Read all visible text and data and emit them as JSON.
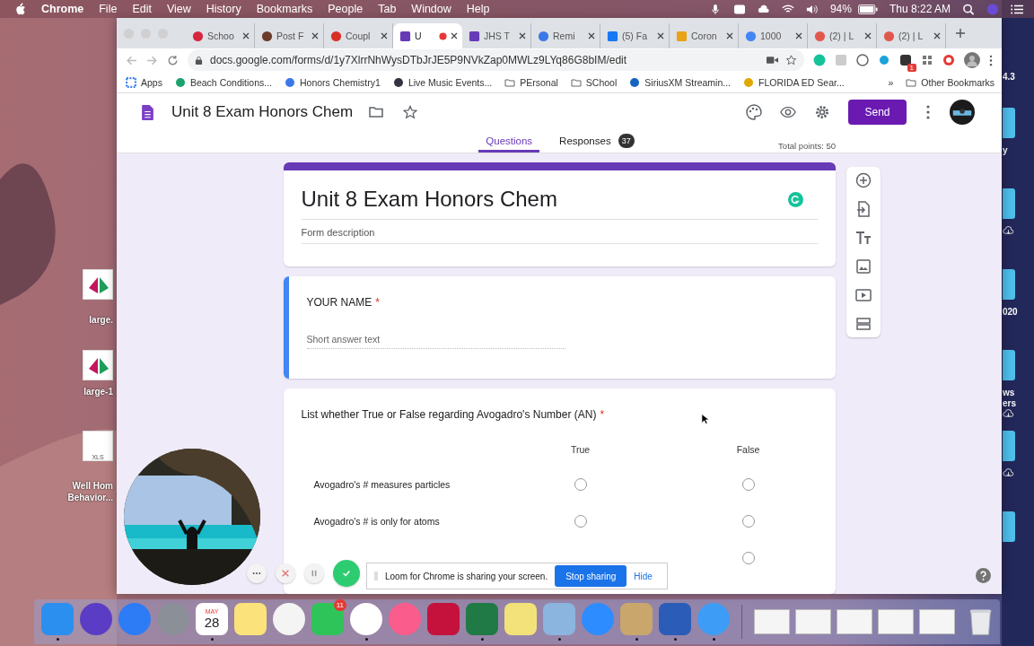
{
  "menu_bar": {
    "app": "Chrome",
    "menus": [
      "File",
      "Edit",
      "View",
      "History",
      "Bookmarks",
      "People",
      "Tab",
      "Window",
      "Help"
    ],
    "battery": "94%",
    "clock": "Thu 8:22 AM"
  },
  "desktop": {
    "left_icons": [
      {
        "kind": "chart",
        "lines": [
          "large."
        ]
      },
      {
        "kind": "chart",
        "lines": [
          "large-1"
        ]
      },
      {
        "kind": "sheet",
        "tag": "XLS",
        "lines": [
          "Well Hom",
          "Behavior..."
        ]
      }
    ],
    "top_label": "4.3",
    "right_icons": [
      {
        "lines": [
          "y"
        ],
        "cloud": false
      },
      {
        "cloud": true
      },
      {
        "lines": [
          "020"
        ],
        "cloud": false
      },
      {
        "lines": [
          "ws",
          "ers"
        ],
        "cloud": true
      },
      {
        "cloud": true
      },
      {
        "cloud": false
      }
    ]
  },
  "browser": {
    "tabs": [
      {
        "title": "Schoo",
        "selected": false,
        "recording": false
      },
      {
        "title": "Post F",
        "selected": false,
        "recording": false
      },
      {
        "title": "Coupl",
        "selected": false,
        "recording": false
      },
      {
        "title": "U",
        "selected": true,
        "recording": true
      },
      {
        "title": "JHS T",
        "selected": false,
        "recording": false
      },
      {
        "title": "Remi",
        "selected": false,
        "recording": false
      },
      {
        "title": "(5) Fa",
        "selected": false,
        "recording": false
      },
      {
        "title": "Coron",
        "selected": false,
        "recording": false
      },
      {
        "title": "1000",
        "selected": false,
        "recording": false
      },
      {
        "title": "(2) | L",
        "selected": false,
        "recording": false
      },
      {
        "title": "(2) | L",
        "selected": false,
        "recording": false
      }
    ],
    "url": "docs.google.com/forms/d/1y7XlrrNhWysDTbJrJE5P9NVkZap0MWLz9LYq86G8bIM/edit",
    "extension_badge": "1",
    "bookmarks": [
      "Apps",
      "Beach Conditions...",
      "Honors Chemistry1",
      "Live Music Events...",
      "PErsonal",
      "SChool",
      "SiriusXM Streamin...",
      "FLORIDA ED Sear..."
    ],
    "more_bookmarks": "»",
    "other_bookmarks": "Other Bookmarks"
  },
  "form": {
    "title": "Unit 8 Exam Honors Chem",
    "send": "Send",
    "tabs": [
      {
        "label": "Questions",
        "selected": true
      },
      {
        "label": "Responses",
        "selected": false,
        "count": "37"
      }
    ],
    "total_points": "Total points: 50",
    "header_card": {
      "title": "Unit 8 Exam Honors Chem",
      "placeholder": "Form description"
    },
    "questions": [
      {
        "kind": "short",
        "title": "YOUR NAME",
        "required_mark": "*",
        "selected": true,
        "placeholder": "Short answer text"
      },
      {
        "kind": "grid",
        "title": "List whether True or False regarding Avogadro's Number (AN)",
        "required_mark": "*",
        "selected": false,
        "columns": [
          "True",
          "False"
        ],
        "rows": [
          "Avogadro's # measures particles",
          "Avogadro's # is only for atoms"
        ]
      }
    ]
  },
  "loom": {
    "message": "Loom for Chrome is sharing your screen.",
    "stop": "Stop sharing",
    "hide": "Hide"
  },
  "dock": [
    {
      "running": true
    },
    {
      "running": false
    },
    {
      "running": false
    },
    {
      "running": false
    },
    {
      "running": true,
      "month": "MAY",
      "day": "28"
    },
    {
      "running": false
    },
    {
      "running": false
    },
    {
      "running": false,
      "badge": "11"
    },
    {
      "running": true
    },
    {
      "running": false
    },
    {
      "running": false
    },
    {
      "running": true
    },
    {
      "running": false
    },
    {
      "running": true
    },
    {
      "running": false
    },
    {
      "running": true
    },
    {
      "running": true
    },
    {
      "running": true
    }
  ]
}
